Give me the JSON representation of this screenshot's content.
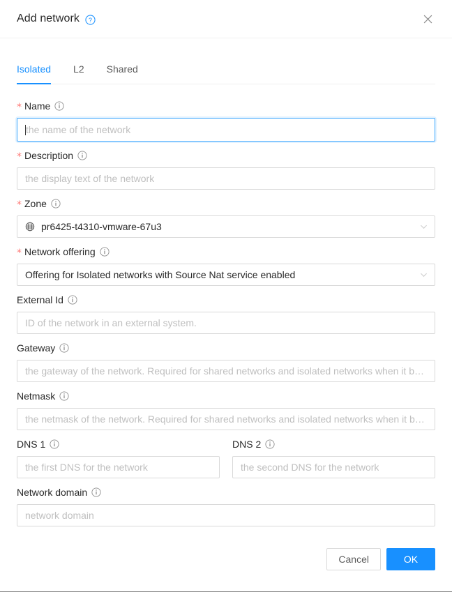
{
  "dialog": {
    "title": "Add network",
    "help_icon": "question-circle-icon",
    "close_icon": "close-icon"
  },
  "tabs": [
    {
      "label": "Isolated",
      "active": true
    },
    {
      "label": "L2",
      "active": false
    },
    {
      "label": "Shared",
      "active": false
    }
  ],
  "accent_color": "#1890ff",
  "required_star_color": "#ff7875",
  "form": {
    "name": {
      "label": "Name",
      "required": true,
      "placeholder": "the name of the network",
      "value": "",
      "focused": true
    },
    "description": {
      "label": "Description",
      "required": true,
      "placeholder": "the display text of the network",
      "value": ""
    },
    "zone": {
      "label": "Zone",
      "required": true,
      "value": "pr6425-t4310-vmware-67u3",
      "icon": "globe-icon"
    },
    "network_offering": {
      "label": "Network offering",
      "required": true,
      "value": "Offering for Isolated networks with Source Nat service enabled"
    },
    "external_id": {
      "label": "External Id",
      "required": false,
      "placeholder": "ID of the network in an external system.",
      "value": ""
    },
    "gateway": {
      "label": "Gateway",
      "required": false,
      "placeholder": "the gateway of the network. Required for shared networks and isolated networks when it belongs to VPC.",
      "value": ""
    },
    "netmask": {
      "label": "Netmask",
      "required": false,
      "placeholder": "the netmask of the network. Required for shared networks and isolated networks when it belongs to VPC.",
      "value": ""
    },
    "dns1": {
      "label": "DNS 1",
      "required": false,
      "placeholder": "the first DNS for the network",
      "value": ""
    },
    "dns2": {
      "label": "DNS 2",
      "required": false,
      "placeholder": "the second DNS for the network",
      "value": ""
    },
    "network_domain": {
      "label": "Network domain",
      "required": false,
      "placeholder": "network domain",
      "value": ""
    }
  },
  "footer": {
    "cancel_label": "Cancel",
    "ok_label": "OK"
  }
}
